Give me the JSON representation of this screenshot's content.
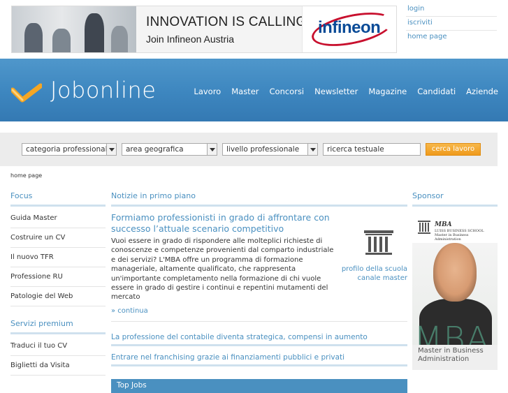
{
  "banner": {
    "headline": "INNOVATION IS CALLING!",
    "subline": "Join Infineon Austria",
    "brand": "infineon"
  },
  "user_links": [
    "login",
    "iscriviti",
    "home page"
  ],
  "header": {
    "logo_text": "Jobonline",
    "nav": [
      "Lavoro",
      "Master",
      "Concorsi",
      "Newsletter",
      "Magazine",
      "Candidati",
      "Aziende"
    ]
  },
  "search": {
    "category": "categoria professionale",
    "area": "area geografica",
    "level": "livello professionale",
    "text_value": "ricerca testuale",
    "button": "cerca lavoro"
  },
  "breadcrumb": "home page",
  "left": {
    "focus_title": "Focus",
    "focus_items": [
      "Guida Master",
      "Costruire un CV",
      "Il nuovo TFR",
      "Professione RU",
      "Patologie del Web"
    ],
    "premium_title": "Servizi premium",
    "premium_items": [
      "Traduci il tuo CV",
      "Biglietti da Visita"
    ]
  },
  "center": {
    "title": "Notizie in primo piano",
    "feature_title": "Formiamo professionisti in grado di affrontare con successo l’attuale scenario competitivo",
    "feature_body": "Vuoi essere in grado di rispondere alle molteplici richieste di conoscenze e competenze provenienti dal comparto industriale e dei servizi? L'MBA offre un programma di formazione manageriale, altamente qualificato, che rappresenta un'importante completamento nella formazione di chi vuole essere in grado di gestire i continui e repentini mutamenti del mercato",
    "feature_more": "» continua",
    "school_link_1": "profilo della scuola",
    "school_link_2": "canale master",
    "news": [
      "La professione del contabile diventa strategica, compensi in aumento",
      "Entrare nel franchising grazie ai finanziamenti pubblici e privati"
    ],
    "topjobs": "Top Jobs"
  },
  "right": {
    "title": "Sponsor",
    "ad_brand": "MBA",
    "ad_school": "LUISS BUSINESS SCHOOL",
    "ad_school_sub": "Master in Business Administration",
    "ad_big": "MBA",
    "ad_foot": "Master in Business Administration"
  },
  "colors": {
    "accent": "#4a90c0",
    "header": "#3d86bf",
    "button": "#f0a029"
  }
}
